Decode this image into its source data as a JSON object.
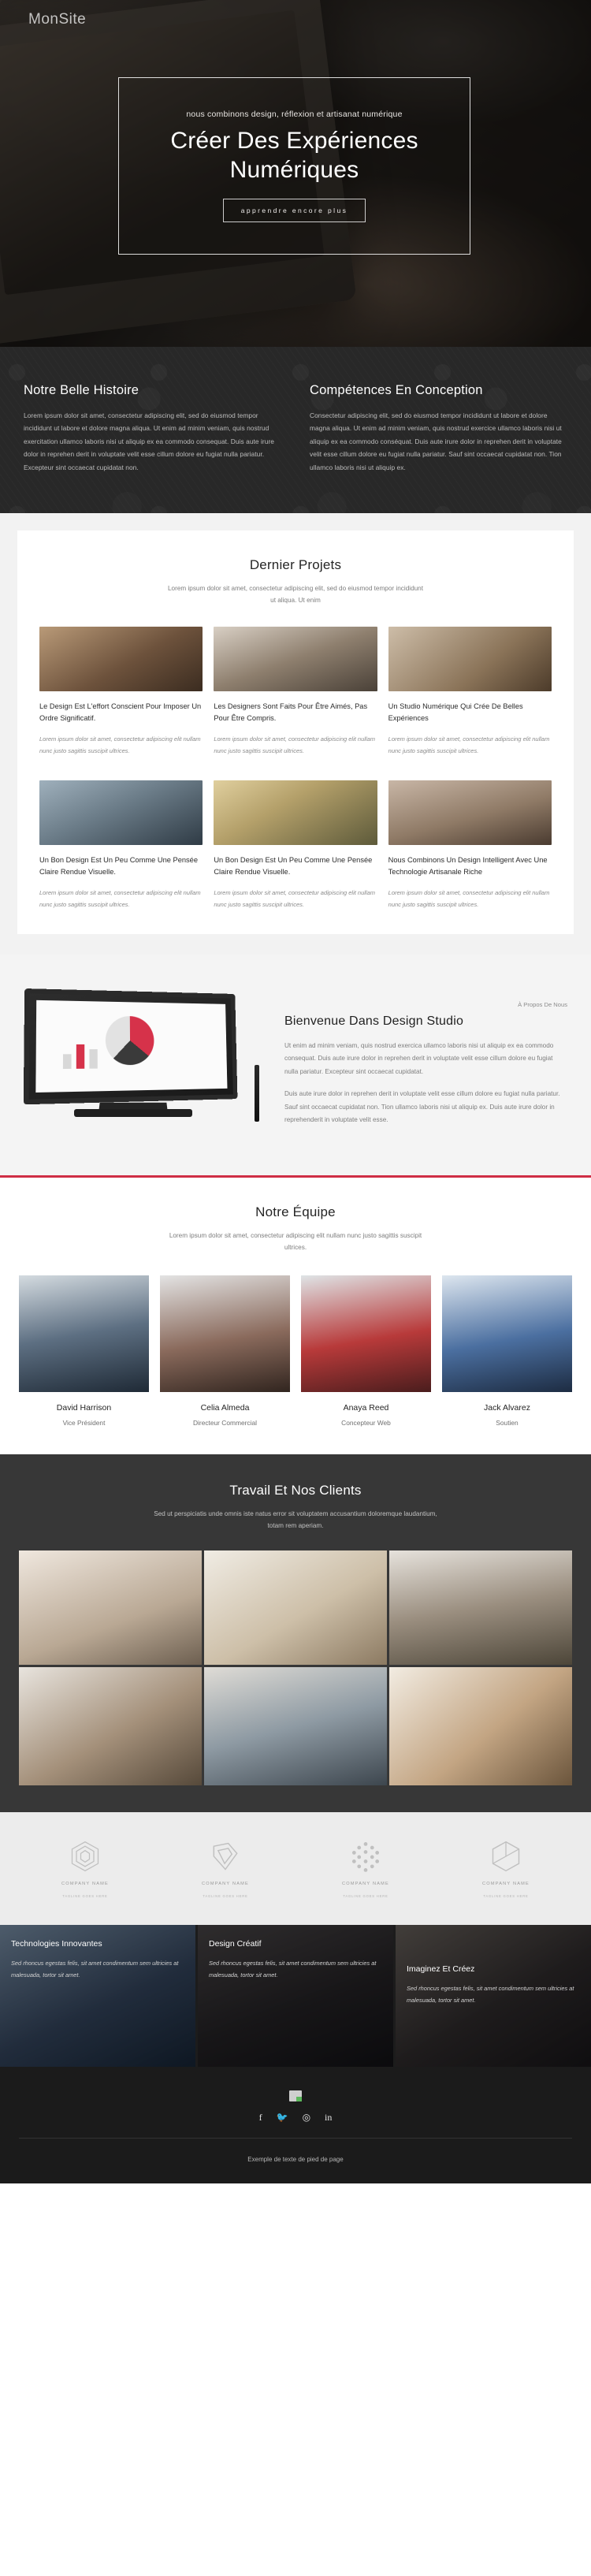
{
  "hero": {
    "logo": "MonSite",
    "kicker": "nous combinons design, réflexion et artisanat numérique",
    "title": "Créer Des Expériences Numériques",
    "button": "apprendre encore plus"
  },
  "intro": {
    "left": {
      "heading": "Notre Belle Histoire",
      "body": "Lorem ipsum dolor sit amet, consectetur adipiscing elit, sed do eiusmod tempor incididunt ut labore et dolore magna aliqua. Ut enim ad minim veniam, quis nostrud exercitation ullamco laboris nisi ut aliquip ex ea commodo consequat. Duis aute irure dolor in reprehen derit in voluptate velit esse cillum dolore eu fugiat nulla pariatur. Excepteur sint occaecat cupidatat non."
    },
    "right": {
      "heading": "Compétences En Conception",
      "body": "Consectetur adipiscing elit, sed do eiusmod tempor incididunt ut labore et dolore magna aliqua. Ut enim ad minim veniam, quis nostrud exercice ullamco laboris nisi ut aliquip ex ea commodo conséquat. Duis aute irure dolor in reprehen derit in voluptate velit esse cillum dolore eu fugiat nulla pariatur. Sauf sint occaecat cupidatat non. Tion ullamco laboris nisi ut aliquip ex."
    }
  },
  "projects": {
    "title": "Dernier Projets",
    "subtitle": "Lorem ipsum dolor sit amet, consectetur adipiscing elit, sed do eiusmod tempor incididunt ut aliqua. Ut enim",
    "items": [
      {
        "title": "Le Design Est L'effort Conscient Pour Imposer Un Ordre Significatif.",
        "body": "Lorem ipsum dolor sit amet, consectetur adipiscing elit nullam nunc justo sagittis suscipit ultrices."
      },
      {
        "title": "Les Designers Sont Faits Pour Être Aimés, Pas Pour Être Compris.",
        "body": "Lorem ipsum dolor sit amet, consectetur adipiscing elit nullam nunc justo sagittis suscipit ultrices."
      },
      {
        "title": "Un Studio Numérique Qui Crée De Belles Expériences",
        "body": "Lorem ipsum dolor sit amet, consectetur adipiscing elit nullam nunc justo sagittis suscipit ultrices."
      },
      {
        "title": "Un Bon Design Est Un Peu Comme Une Pensée Claire Rendue Visuelle.",
        "body": "Lorem ipsum dolor sit amet, consectetur adipiscing elit nullam nunc justo sagittis suscipit ultrices."
      },
      {
        "title": "Un Bon Design Est Un Peu Comme Une Pensée Claire Rendue Visuelle.",
        "body": "Lorem ipsum dolor sit amet, consectetur adipiscing elit nullam nunc justo sagittis suscipit ultrices."
      },
      {
        "title": "Nous Combinons Un Design Intelligent Avec Une Technologie Artisanale Riche",
        "body": "Lorem ipsum dolor sit amet, consectetur adipiscing elit nullam nunc justo sagittis suscipit ultrices."
      }
    ]
  },
  "about": {
    "kicker": "À Propos De Nous",
    "heading": "Bienvenue Dans Design Studio",
    "para1": "Ut enim ad minim veniam, quis nostrud exercica ullamco laboris nisi ut aliquip ex ea commodo consequat. Duis aute irure dolor in reprehen derit in voluptate velit esse cillum dolore eu fugiat nulla pariatur. Excepteur sint occaecat cupidatat.",
    "para2": "Duis aute irure dolor in reprehen derit in voluptate velit esse cillum dolore eu fugiat nulla pariatur. Sauf sint occaecat cupidatat non. Tion ullamco laboris nisi ut aliquip ex. Duis aute irure dolor in reprehenderit in voluptate velit esse."
  },
  "team": {
    "title": "Notre Équipe",
    "subtitle": "Lorem ipsum dolor sit amet, consectetur adipiscing elit nullam nunc justo sagittis suscipit ultrices.",
    "members": [
      {
        "name": "David Harrison",
        "role": "Vice Président"
      },
      {
        "name": "Celia Almeda",
        "role": "Directeur Commercial"
      },
      {
        "name": "Anaya Reed",
        "role": "Concepteur Web"
      },
      {
        "name": "Jack Alvarez",
        "role": "Soutien"
      }
    ]
  },
  "clients": {
    "title": "Travail Et Nos Clients",
    "subtitle": "Sed ut perspiciatis unde omnis iste natus error sit voluptatem accusantium doloremque laudantium, totam rem aperiam."
  },
  "logos": [
    {
      "name": "Company Name",
      "tagline": "Tagline goes here",
      "icon": "cube-outline-icon"
    },
    {
      "name": "Company Name",
      "tagline": "Tagline goes here",
      "icon": "chevron-shield-icon"
    },
    {
      "name": "Company Name",
      "tagline": "Tagline goes here",
      "icon": "dot-grid-icon"
    },
    {
      "name": "Company Name",
      "tagline": "Tagline goes here",
      "icon": "hexagon-icon"
    }
  ],
  "features": [
    {
      "title": "Technologies Innovantes",
      "body": "Sed rhoncus egestas felis, sit amet condimentum sem ultricies at malesuada, tortor sit amet."
    },
    {
      "title": "Design Créatif",
      "body": "Sed rhoncus egestas felis, sit amet condimentum sem ultricies at malesuada, tortor sit amet."
    },
    {
      "title": "Imaginez Et Créez",
      "body": "Sed rhoncus egestas felis, sit amet condimentum sem ultricies at malesuada, tortor sit amet."
    }
  ],
  "footer": {
    "social": [
      {
        "icon": "facebook-icon",
        "glyph": "f"
      },
      {
        "icon": "twitter-icon",
        "glyph": "🐦"
      },
      {
        "icon": "instagram-icon",
        "glyph": "◎"
      },
      {
        "icon": "linkedin-icon",
        "glyph": "in"
      }
    ],
    "copyright": "Exemple de texte de pied de page"
  },
  "colors": {
    "accent": "#cf2e45",
    "dark": "#282828",
    "darker": "#1b1b1b"
  }
}
